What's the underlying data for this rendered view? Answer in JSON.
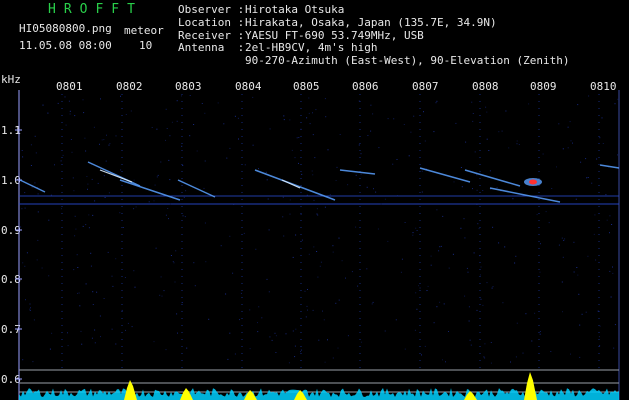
{
  "header": {
    "title": "HROFFT",
    "filename": "HI05080800.png",
    "datetime": "11.05.08 08:00",
    "meteor_label": "meteor",
    "meteor_count": "10",
    "observer_label": "Observer :",
    "observer_value": "Hirotaka Otsuka",
    "location_label": "Location :",
    "location_value": "Hirakata, Osaka, Japan (135.7E, 34.9N)",
    "receiver_label": "Receiver :",
    "receiver_value": "YAESU FT-690 53.749MHz, USB",
    "antenna_label": "Antenna  :",
    "antenna_value": "2el-HB9CV, 4m's high",
    "antenna_value2": "90-270-Azimuth (East-West), 90-Elevation (Zenith)"
  },
  "axis": {
    "unit": "kHz",
    "y_labels": [
      "1.1",
      "1.0",
      "0.9",
      "0.8",
      "0.7",
      "0.6"
    ],
    "x_labels": [
      "0801",
      "0802",
      "0803",
      "0804",
      "0805",
      "0806",
      "0807",
      "0808",
      "0809",
      "0810"
    ]
  },
  "colors": {
    "background": "#000000",
    "grid": "#1e3cb4",
    "trail": "#5aa0ff",
    "trail_bright": "#e0f0ff",
    "hotspot": "#ff3030",
    "spectrum": "#00d0ff",
    "peak": "#ffff00",
    "title": "#29d04a"
  }
}
